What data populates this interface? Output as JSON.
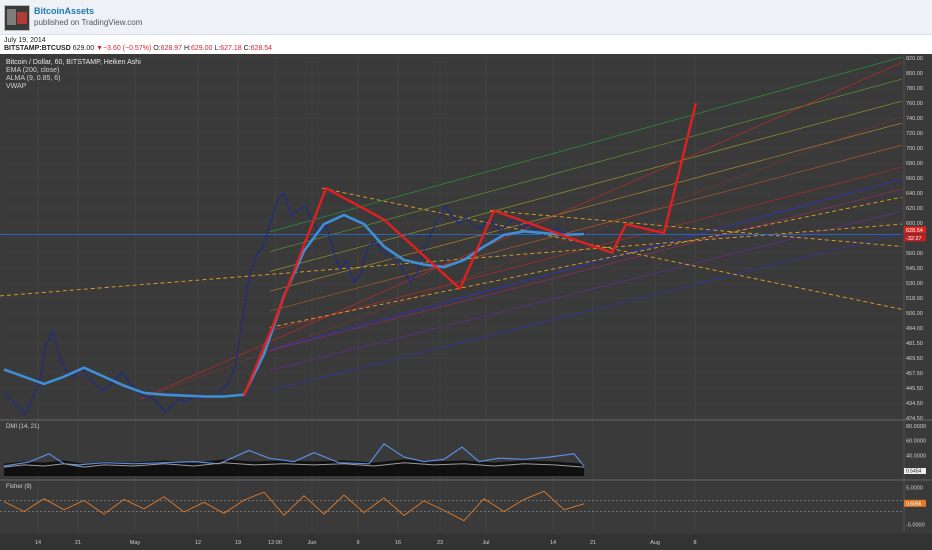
{
  "header": {
    "username": "BitcoinAssets",
    "published": "published on TradingView.com",
    "date": "July 19, 2014"
  },
  "ticker": {
    "symbol": "BITSTAMP:BTCUSD",
    "last": "629.00",
    "change": "▼−3.60 (−0.57%)",
    "open_k": "O:",
    "open": "628.97",
    "high_k": "H:",
    "high": "629.00",
    "low_k": "L:",
    "low": "627.18",
    "close_k": "C:",
    "close": "628.54"
  },
  "legend": {
    "main": "Bitcoin / Dollar, 60, BITSTAMP, Heiken Ashi",
    "ema": "EMA (200, close)",
    "alma": "ALMA (9, 0.85, 6)",
    "vwap": "VWAP"
  },
  "colors": {
    "background": "#3a3a3a",
    "price_line": "#1c2a8a",
    "ema": "#3d8fd8",
    "projection": "#e02020",
    "channel_dash": "#e8a020",
    "dmi_plus": "#5b8de0",
    "dmi_minus": "#9a9a9a",
    "fisher": "#e07a2a"
  },
  "chart_data": [
    {
      "type": "line",
      "title": "Bitcoin / Dollar, 60, BITSTAMP, Heiken Ashi",
      "x_tick_labels": [
        "14",
        "21",
        "May",
        "12",
        "19",
        "12:00",
        "Jun",
        "9",
        "16",
        "23",
        "Jul",
        "14",
        "21",
        "Aug",
        "8"
      ],
      "y_tick_labels": [
        "820.00",
        "800.00",
        "780.00",
        "760.00",
        "740.00",
        "720.00",
        "700.00",
        "680.00",
        "660.00",
        "640.00",
        "620.00",
        "600.00",
        "580.00",
        "560.00",
        "545.00",
        "530.00",
        "518.00",
        "506.00",
        "494.00",
        "481.50",
        "469.50",
        "457.50",
        "445.50",
        "434.50",
        "424.50"
      ],
      "price_label": "628.54",
      "price_label2": "-32:27",
      "series": [
        {
          "name": "Bitcoin / Dollar",
          "x": [
            0,
            7,
            14,
            21,
            28,
            35,
            42,
            49,
            56,
            63,
            70,
            77,
            84,
            91,
            98,
            105,
            112,
            119,
            126,
            133,
            140,
            147,
            154,
            161,
            168,
            175,
            182,
            189,
            196,
            203,
            210,
            217,
            224,
            231,
            238,
            245,
            252,
            259,
            266,
            273,
            280,
            287,
            294,
            301,
            308,
            315,
            322,
            329,
            336,
            343,
            350,
            357,
            364,
            371,
            378,
            385,
            392,
            399,
            406,
            413,
            420,
            427,
            434,
            441,
            448,
            455,
            462,
            469,
            476,
            483,
            490,
            497,
            504,
            511,
            518,
            525,
            532,
            539,
            546,
            553,
            560,
            567,
            574,
            581
          ],
          "y": [
            452,
            445,
            437,
            428,
            445,
            462,
            505,
            520,
            490,
            475,
            470,
            480,
            470,
            462,
            455,
            460,
            468,
            475,
            462,
            455,
            448,
            448,
            440,
            430,
            438,
            445,
            442,
            448,
            446,
            448,
            448,
            455,
            462,
            480,
            530,
            580,
            605,
            615,
            640,
            665,
            675,
            650,
            655,
            660,
            645,
            630,
            640,
            610,
            590,
            600,
            575,
            585,
            615,
            620,
            610,
            605,
            600,
            590,
            575,
            585,
            610,
            630,
            645,
            660,
            650,
            640,
            648,
            638,
            635,
            645,
            640,
            632,
            640,
            648,
            635,
            640,
            632,
            628,
            632,
            636,
            630,
            628,
            630,
            629
          ]
        },
        {
          "name": "EMA (200, close)",
          "x": [
            0,
            20,
            40,
            60,
            80,
            100,
            120,
            140,
            160,
            180,
            200,
            220,
            240,
            260,
            280,
            300,
            320,
            340,
            360,
            380,
            400,
            420,
            440,
            460,
            480,
            500,
            520,
            540,
            560,
            580
          ],
          "y": [
            478,
            470,
            462,
            470,
            480,
            470,
            460,
            452,
            450,
            449,
            448,
            448,
            450,
            495,
            560,
            610,
            640,
            650,
            640,
            615,
            600,
            595,
            592,
            600,
            615,
            628,
            632,
            630,
            628,
            629
          ]
        },
        {
          "name": "Projection",
          "x": [
            240,
            270,
            322,
            380,
            456,
            490,
            560,
            608,
            622,
            660,
            692
          ],
          "y": [
            449,
            530,
            680,
            645,
            568,
            655,
            627,
            608,
            640,
            630,
            775
          ]
        }
      ]
    },
    {
      "type": "line",
      "title": "DMI (14, 21)",
      "y_tick_labels": [
        "80.0000",
        "60.0000",
        "40.0000",
        "20.0000"
      ],
      "value_label": "0.5454",
      "series": [
        {
          "name": "DMI+",
          "x": [
            0,
            25,
            45,
            60,
            75,
            100,
            130,
            160,
            190,
            215,
            245,
            265,
            290,
            310,
            335,
            365,
            380,
            400,
            420,
            440,
            458,
            475,
            495,
            520,
            545,
            570,
            580
          ],
          "y": [
            18,
            25,
            40,
            22,
            20,
            24,
            22,
            24,
            26,
            22,
            46,
            32,
            26,
            42,
            24,
            22,
            58,
            34,
            26,
            30,
            52,
            26,
            32,
            30,
            34,
            40,
            18
          ]
        },
        {
          "name": "DMI−",
          "x": [
            0,
            20,
            40,
            60,
            80,
            100,
            130,
            160,
            190,
            220,
            250,
            280,
            310,
            340,
            370,
            400,
            430,
            460,
            490,
            520,
            550,
            580
          ],
          "y": [
            16,
            20,
            18,
            22,
            16,
            20,
            18,
            22,
            18,
            24,
            20,
            22,
            20,
            22,
            18,
            24,
            20,
            22,
            18,
            22,
            20,
            16
          ]
        }
      ]
    },
    {
      "type": "line",
      "title": "Fisher (9)",
      "y_tick_labels": [
        "5.0000",
        "-5.0000"
      ],
      "value_label": "0.6066",
      "series": [
        {
          "name": "Fisher",
          "x": [
            0,
            20,
            40,
            60,
            80,
            100,
            120,
            140,
            160,
            180,
            200,
            220,
            240,
            260,
            280,
            300,
            320,
            340,
            360,
            380,
            400,
            420,
            440,
            460,
            480,
            500,
            520,
            540,
            560,
            580
          ],
          "y": [
            1.2,
            -1.5,
            2.0,
            -1.0,
            1.5,
            -2.2,
            1.8,
            -0.8,
            2.5,
            -1.6,
            1.0,
            -2.0,
            1.6,
            3.8,
            -2.5,
            2.8,
            -2.2,
            3.0,
            -1.8,
            2.2,
            -2.6,
            1.4,
            -1.2,
            -4.0,
            2.0,
            -1.5,
            1.8,
            4.0,
            -1.0,
            0.6
          ]
        }
      ]
    }
  ]
}
